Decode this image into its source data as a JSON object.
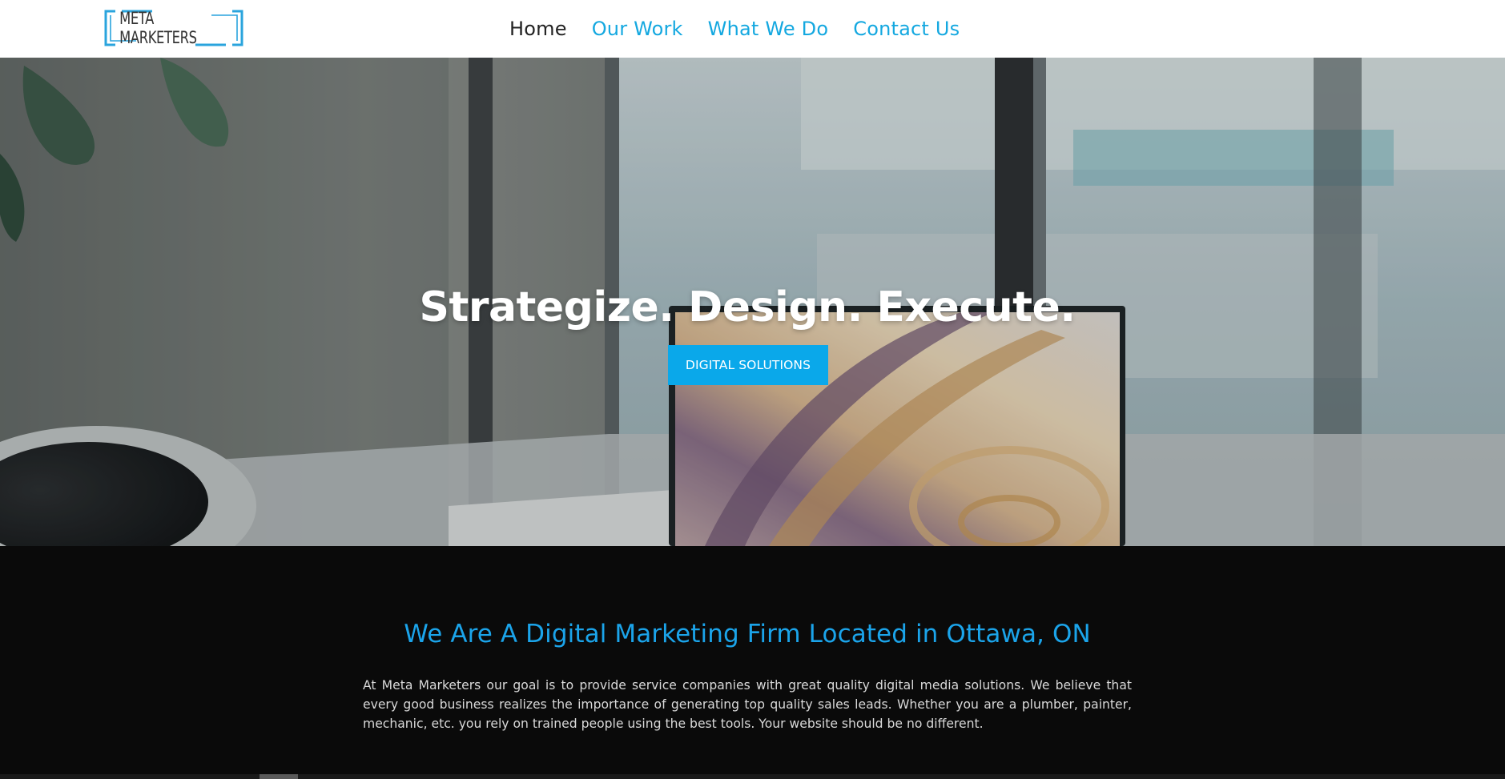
{
  "header": {
    "logo_text": "META MARKETERS",
    "nav": [
      {
        "label": "Home",
        "active": true
      },
      {
        "label": "Our Work",
        "active": false
      },
      {
        "label": "What We Do",
        "active": false
      },
      {
        "label": "Contact Us",
        "active": false
      }
    ]
  },
  "hero": {
    "title": "Strategize. Design. Execute.",
    "cta_label": "DIGITAL SOLUTIONS"
  },
  "about": {
    "title": "We Are A Digital Marketing Firm Located in Ottawa, ON",
    "body": "At Meta Marketers our goal is to provide service companies with great quality digital media solutions. We believe that every good business realizes the importance of generating top quality sales leads. Whether you are a plumber, painter, mechanic, etc. you rely on trained people using the best tools. Your website should be no different."
  },
  "colors": {
    "accent": "#0aa8ea",
    "nav_link": "#14a8e0",
    "nav_active": "#222222",
    "section_bg": "#0a0a0a"
  }
}
